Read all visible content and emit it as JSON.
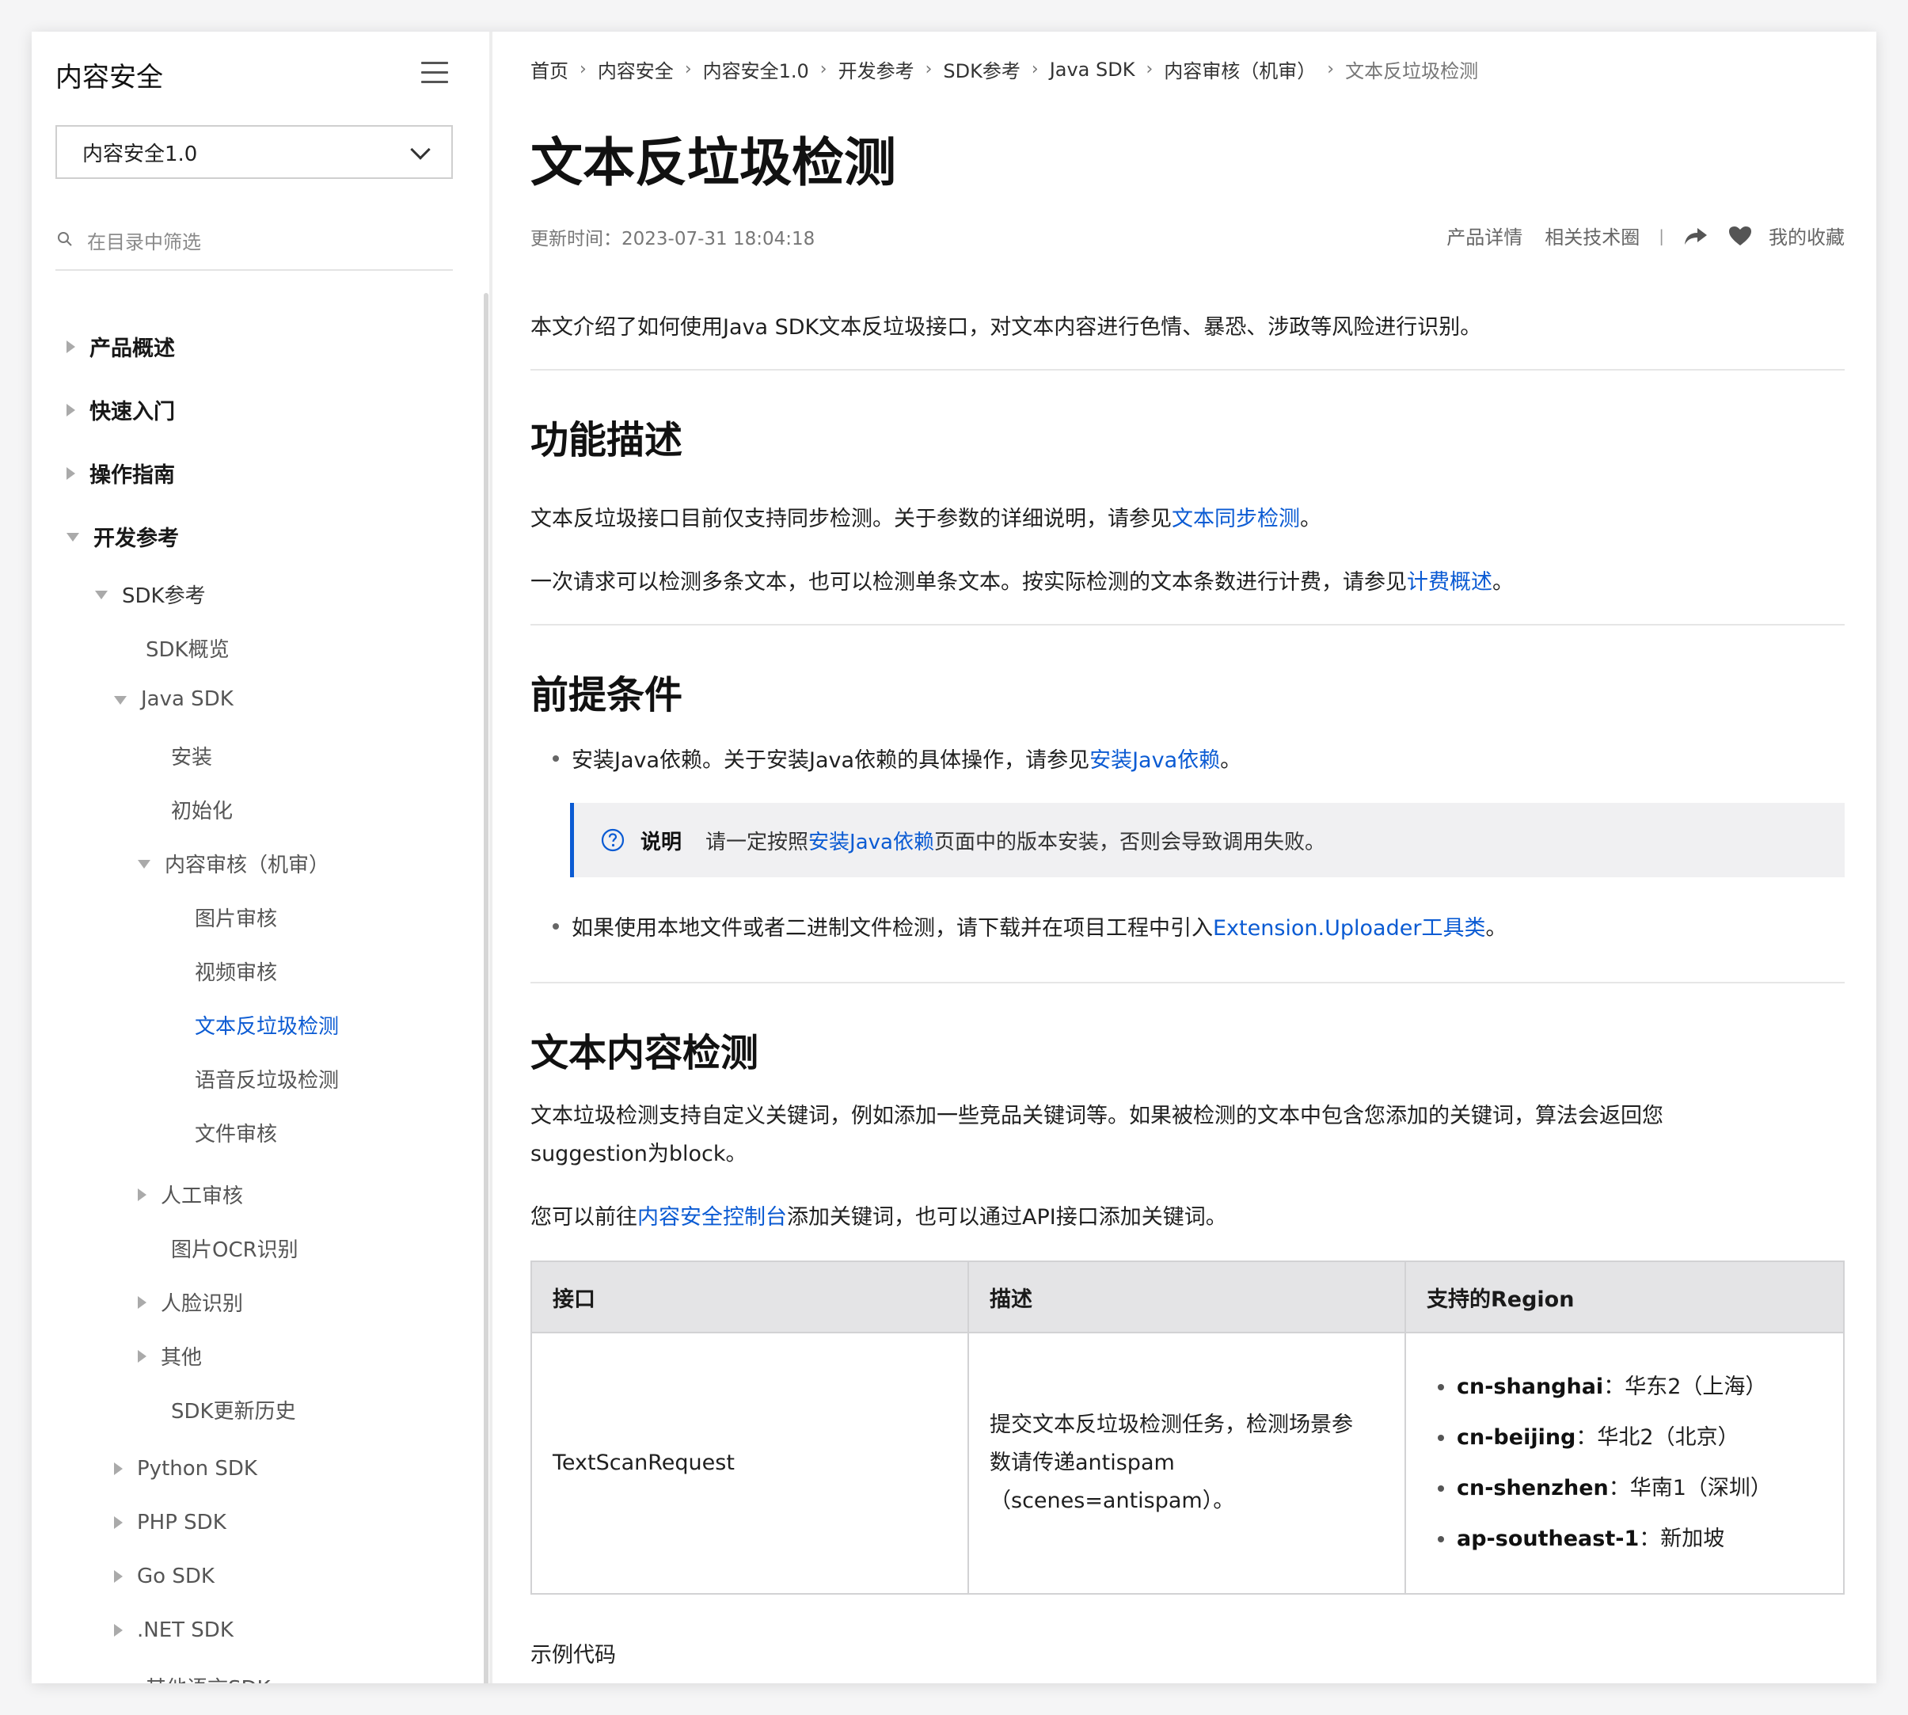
{
  "sidebar": {
    "title": "内容安全",
    "version": "内容安全1.0",
    "filter_placeholder": "在目录中筛选",
    "items": [
      {
        "label": "产品概述"
      },
      {
        "label": "快速入门"
      },
      {
        "label": "操作指南"
      },
      {
        "label": "开发参考"
      },
      {
        "label": "SDK参考"
      },
      {
        "label": "SDK概览"
      },
      {
        "label": "Java SDK"
      },
      {
        "label": "安装"
      },
      {
        "label": "初始化"
      },
      {
        "label": "内容审核（机审）"
      },
      {
        "label": "图片审核"
      },
      {
        "label": "视频审核"
      },
      {
        "label": "文本反垃圾检测"
      },
      {
        "label": "语音反垃圾检测"
      },
      {
        "label": "文件审核"
      },
      {
        "label": "人工审核"
      },
      {
        "label": "图片OCR识别"
      },
      {
        "label": "人脸识别"
      },
      {
        "label": "其他"
      },
      {
        "label": "SDK更新历史"
      },
      {
        "label": "Python SDK"
      },
      {
        "label": "PHP SDK"
      },
      {
        "label": "Go SDK"
      },
      {
        "label": ".NET SDK"
      },
      {
        "label": "其他语言SDK"
      }
    ]
  },
  "breadcrumb": [
    "首页",
    "内容安全",
    "内容安全1.0",
    "开发参考",
    "SDK参考",
    "Java SDK",
    "内容审核（机审）",
    "文本反垃圾检测"
  ],
  "page": {
    "title": "文本反垃圾检测",
    "updated": "更新时间：2023-07-31 18:04:18",
    "actions": {
      "product": "产品详情",
      "tech": "相关技术圈",
      "favorite": "我的收藏"
    },
    "intro": "本文介绍了如何使用Java SDK文本反垃圾接口，对文本内容进行色情、暴恐、涉政等风险进行识别。"
  },
  "features": {
    "heading": "功能描述",
    "p1_text": "文本反垃圾接口目前仅支持同步检测。关于参数的详细说明，请参见",
    "p1_link": "文本同步检测",
    "p1_end": "。",
    "p2_text": "一次请求可以检测多条文本，也可以检测单条文本。按实际检测的文本条数进行计费，请参见",
    "p2_link": "计费概述",
    "p2_end": "。"
  },
  "prereq": {
    "heading": "前提条件",
    "b1_text": "安装Java依赖。关于安装Java依赖的具体操作，请参见",
    "b1_link": "安装Java依赖",
    "b1_end": "。",
    "note_label": "说明",
    "note_text": "请一定按照",
    "note_link": "安装Java依赖",
    "note_end": "页面中的版本安装，否则会导致调用失败。",
    "b2_text": "如果使用本地文件或者二进制文件检测，请下载并在项目工程中引入",
    "b2_link": "Extension.Uploader工具类",
    "b2_end": "。"
  },
  "text_detect": {
    "heading": "文本内容检测",
    "p1_line1": "文本垃圾检测支持自定义关键词，例如添加一些竞品关键词等。如果被检测的文本中包含您添加的关键词，算法会返回您",
    "p1_line2": "suggestion为block。",
    "p2_text": "您可以前往",
    "p2_link": "内容安全控制台",
    "p2_end": "添加关键词，也可以通过API接口添加关键词。"
  },
  "table": {
    "headers": [
      "接口",
      "描述",
      "支持的Region"
    ],
    "api": "TextScanRequest",
    "desc": [
      "提交文本反垃圾检测任务，检测场景参",
      "数请传递antispam",
      "（scenes=antispam）。"
    ],
    "regions": [
      {
        "code": "cn-shanghai",
        "name": "：华东2（上海）"
      },
      {
        "code": "cn-beijing",
        "name": "：华北2（北京）"
      },
      {
        "code": "cn-shenzhen",
        "name": "：华南1（深圳）"
      },
      {
        "code": "ap-southeast-1",
        "name": "：新加坡"
      }
    ]
  },
  "sample_label": "示例代码",
  "colors": {
    "link": "#0b5bd3",
    "accent_border": "#0b5bd3",
    "note_bg": "#f0f0f2"
  }
}
